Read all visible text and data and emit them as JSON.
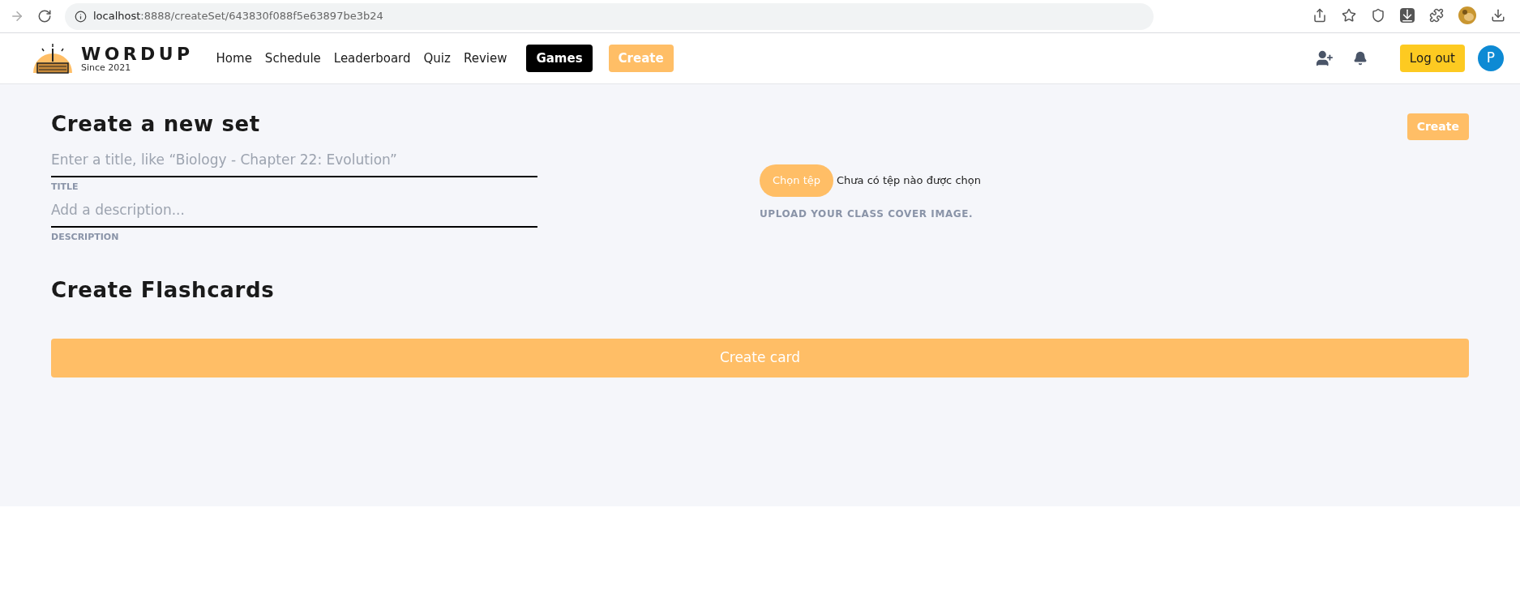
{
  "browser": {
    "url_host": "localhost",
    "url_rest": ":8888/createSet/643830f088f5e63897be3b24"
  },
  "navbar": {
    "brand": "WORDUP",
    "tagline": "Since 2021",
    "links": [
      {
        "label": "Home",
        "kind": "link"
      },
      {
        "label": "Schedule",
        "kind": "link"
      },
      {
        "label": "Leaderboard",
        "kind": "link"
      },
      {
        "label": "Quiz",
        "kind": "link"
      },
      {
        "label": "Review",
        "kind": "link"
      },
      {
        "label": "Games",
        "kind": "dark"
      },
      {
        "label": "Create",
        "kind": "accent"
      }
    ],
    "logout": "Log out",
    "avatar": "P"
  },
  "page": {
    "title": "Create a new set",
    "create_button": "Create",
    "fields": [
      {
        "placeholder": "Enter a title, like “Biology - Chapter 22: Evolution”",
        "label": "TITLE"
      },
      {
        "placeholder": "Add a description...",
        "label": "DESCRIPTION"
      }
    ],
    "file_button": "Chọn tệp",
    "file_status": "Chưa có tệp nào được chọn",
    "upload_label": "UPLOAD YOUR CLASS COVER IMAGE.",
    "section_title": "Create Flashcards",
    "create_card": "Create card"
  }
}
